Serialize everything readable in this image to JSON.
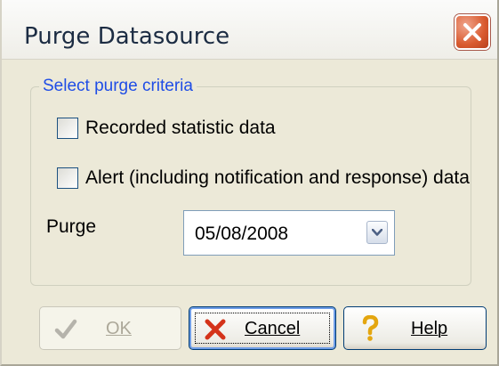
{
  "window": {
    "title": "Purge Datasource",
    "close_icon": "close-icon"
  },
  "criteria": {
    "legend": "Select purge criteria",
    "recorded_statistic": {
      "label": "Recorded statistic data",
      "checked": false
    },
    "alert_data": {
      "label": "Alert (including notification and response) data",
      "checked": false
    }
  },
  "purge": {
    "label": "Purge",
    "date_value": "05/08/2008"
  },
  "buttons": {
    "ok": {
      "label": "OK",
      "icon": "checkmark-icon",
      "enabled": false
    },
    "cancel": {
      "label": "Cancel",
      "icon": "x-icon"
    },
    "help": {
      "label": "Help",
      "icon": "question-mark-icon"
    }
  },
  "colors": {
    "legend_text": "#1f4de6",
    "dialog_bg": "#ece9d8",
    "close_button": "#d95a2f"
  }
}
